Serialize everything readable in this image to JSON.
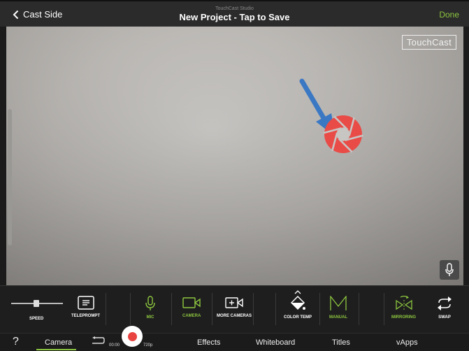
{
  "topbar": {
    "back_label": "Cast Side",
    "app_name": "TouchCast Studio",
    "title": "New Project - Tap to Save",
    "done_label": "Done"
  },
  "preview": {
    "watermark": "TouchCast"
  },
  "tools": {
    "speed": "SPEED",
    "teleprompt": "TELEPROMPT",
    "mic": "MIC",
    "camera": "CAMERA",
    "more_cameras": "MORE CAMERAS",
    "color_temp": "COLOR TEMP",
    "manual": "MANUAL",
    "mirroring": "MIRRORING",
    "swap": "SWAP"
  },
  "nav": {
    "help": "?",
    "camera": "Camera",
    "effects": "Effects",
    "whiteboard": "Whiteboard",
    "titles": "Titles",
    "vapps": "vApps",
    "time": "00:00",
    "resolution": "720p"
  },
  "colors": {
    "accent_green": "#8dc63f",
    "record_red": "#e8433f",
    "arrow_blue": "#3b78c3"
  }
}
